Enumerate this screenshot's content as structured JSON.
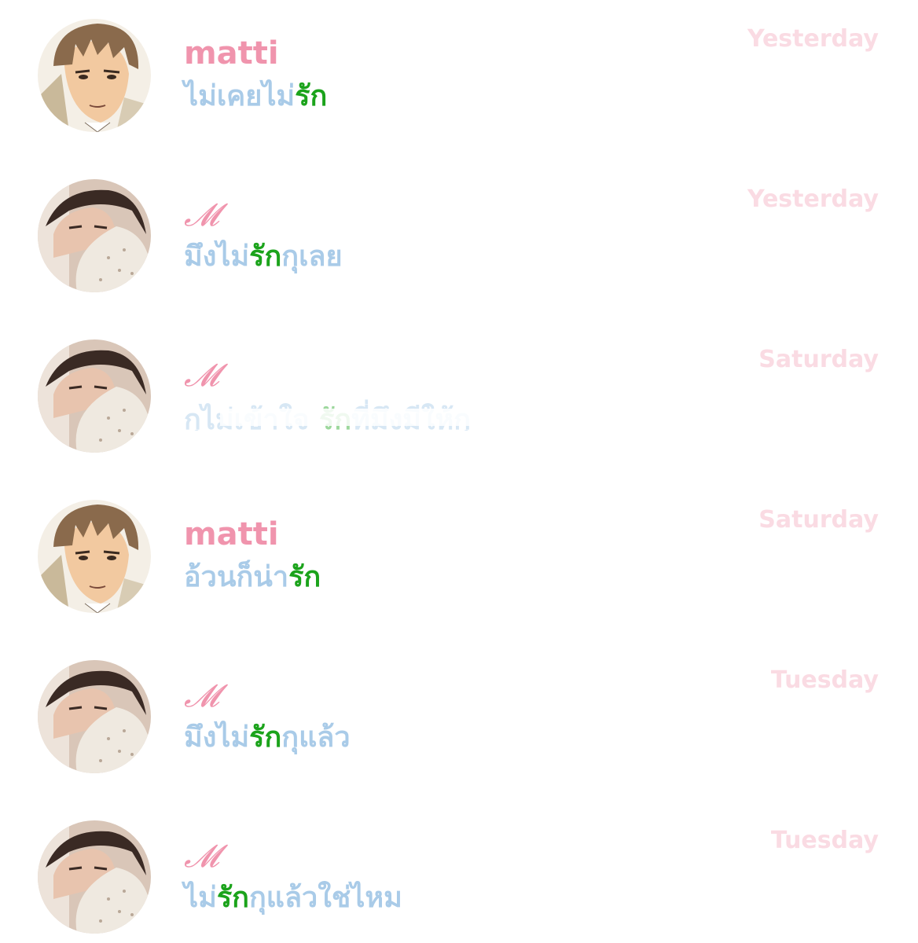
{
  "conversations": [
    {
      "avatar": "anime-man-avatar",
      "name": "matti",
      "name_style": "plain",
      "message_parts": [
        {
          "text": "ไม่เคยไม่",
          "highlight": false
        },
        {
          "text": "รัก",
          "highlight": true
        }
      ],
      "time": "Yesterday"
    },
    {
      "avatar": "girl-photo-avatar",
      "name": "𝓜",
      "name_style": "script",
      "message_parts": [
        {
          "text": "มึงไม่",
          "highlight": false
        },
        {
          "text": "รัก",
          "highlight": true
        },
        {
          "text": "กุเลย",
          "highlight": false
        }
      ],
      "time": "Yesterday"
    },
    {
      "avatar": "girl-photo-avatar",
      "name": "𝓜",
      "name_style": "script",
      "message_parts": [
        {
          "text": "กุไม่เข้าใจ ",
          "highlight": false
        },
        {
          "text": "รัก",
          "highlight": true
        },
        {
          "text": "ที่มึงมีให้กุ",
          "highlight": false
        }
      ],
      "message_faded": true,
      "time": "Saturday"
    },
    {
      "avatar": "anime-man-avatar",
      "name": "matti",
      "name_style": "plain",
      "message_parts": [
        {
          "text": "อ้วนก็น่า",
          "highlight": false
        },
        {
          "text": "รัก",
          "highlight": true
        }
      ],
      "time": "Saturday"
    },
    {
      "avatar": "girl-photo-avatar",
      "name": "𝓜",
      "name_style": "script",
      "message_parts": [
        {
          "text": "มึงไม่",
          "highlight": false
        },
        {
          "text": "รัก",
          "highlight": true
        },
        {
          "text": "กุแล้ว",
          "highlight": false
        }
      ],
      "time": "Tuesday"
    },
    {
      "avatar": "girl-photo-avatar",
      "name": "𝓜",
      "name_style": "script",
      "message_parts": [
        {
          "text": "ไม่",
          "highlight": false
        },
        {
          "text": "รัก",
          "highlight": true
        },
        {
          "text": "กุแล้วใช่ไหม",
          "highlight": false
        }
      ],
      "time": "Tuesday"
    }
  ]
}
